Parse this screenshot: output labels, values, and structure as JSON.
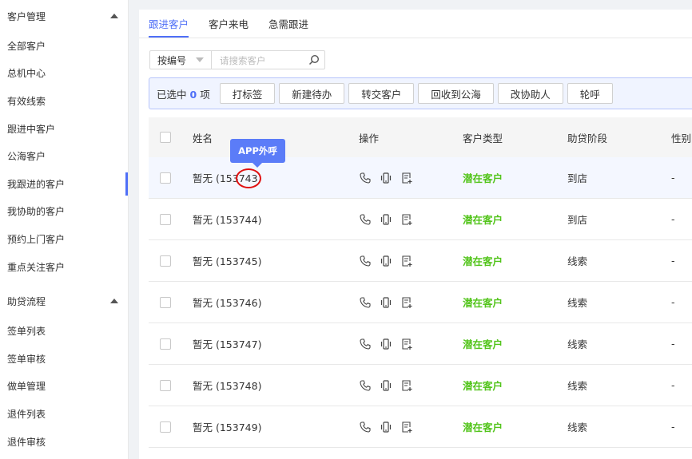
{
  "sidebar": {
    "group1": {
      "label": "客户管理"
    },
    "items1": [
      "全部客户",
      "总机中心",
      "有效线索",
      "跟进中客户",
      "公海客户",
      "我跟进的客户",
      "我协助的客户",
      "预约上门客户",
      "重点关注客户"
    ],
    "group2": {
      "label": "助贷流程"
    },
    "items2": [
      "签单列表",
      "签单审核",
      "做单管理",
      "退件列表",
      "退件审核"
    ],
    "active_item": "我跟进的客户"
  },
  "tabs": [
    "跟进客户",
    "客户来电",
    "急需跟进"
  ],
  "active_tab": "跟进客户",
  "search": {
    "select_value": "按编号",
    "placeholder": "请搜索客户"
  },
  "toolbar": {
    "selected_prefix": "已选中",
    "selected_count": "0",
    "selected_suffix": "项",
    "buttons": [
      "打标签",
      "新建待办",
      "转交客户",
      "回收到公海",
      "改协助人",
      "轮呼"
    ]
  },
  "table": {
    "headers": {
      "name": "姓名",
      "ops": "操作",
      "type": "客户类型",
      "stage": "助贷阶段",
      "gender": "性别"
    },
    "rows": [
      {
        "name": "暂无 (153743)",
        "type": "潜在客户",
        "stage": "到店",
        "gender": "-"
      },
      {
        "name": "暂无 (153744)",
        "type": "潜在客户",
        "stage": "到店",
        "gender": "-"
      },
      {
        "name": "暂无 (153745)",
        "type": "潜在客户",
        "stage": "线索",
        "gender": "-"
      },
      {
        "name": "暂无 (153746)",
        "type": "潜在客户",
        "stage": "线索",
        "gender": "-"
      },
      {
        "name": "暂无 (153747)",
        "type": "潜在客户",
        "stage": "线索",
        "gender": "-"
      },
      {
        "name": "暂无 (153748)",
        "type": "潜在客户",
        "stage": "线索",
        "gender": "-"
      },
      {
        "name": "暂无 (153749)",
        "type": "潜在客户",
        "stage": "线索",
        "gender": "-"
      }
    ]
  },
  "tooltip": {
    "text": "APP外呼"
  },
  "icons": {
    "op1": "phone-icon",
    "op2": "mobile-vibrate-icon",
    "op3": "add-note-icon"
  },
  "colors": {
    "accent": "#4f6ff7",
    "type_green": "#52c41a",
    "highlight_red": "#e01010"
  }
}
